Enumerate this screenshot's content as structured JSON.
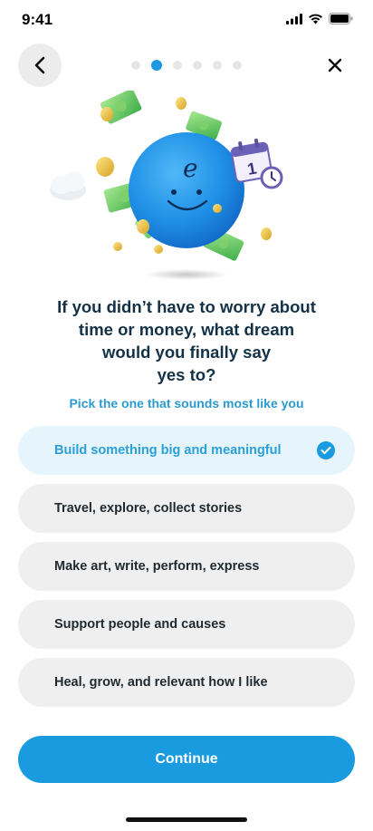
{
  "status_bar": {
    "time": "9:41"
  },
  "header": {
    "back_icon": "chevron-left-icon",
    "close_icon": "close-icon",
    "progress": {
      "total_steps": 6,
      "current_step": 2
    }
  },
  "hero": {
    "mascot_letter": "e"
  },
  "question": {
    "lines": [
      "If you didn’t have to worry about",
      "time or money, what dream",
      "would you finally say",
      "yes to?"
    ]
  },
  "subtitle": "Pick the one that sounds most like you",
  "options": [
    {
      "label": "Build something big and meaningful",
      "selected": true
    },
    {
      "label": "Travel, explore, collect stories",
      "selected": false
    },
    {
      "label": "Make art, write, perform, express",
      "selected": false
    },
    {
      "label": "Support people and causes",
      "selected": false
    },
    {
      "label": "Heal, grow, and relevant how I like",
      "selected": false
    }
  ],
  "continue_label": "Continue",
  "colors": {
    "accent": "#1a9be0",
    "selected_bg": "#e6f5fc",
    "option_bg": "#efefef",
    "heading": "#143247"
  }
}
